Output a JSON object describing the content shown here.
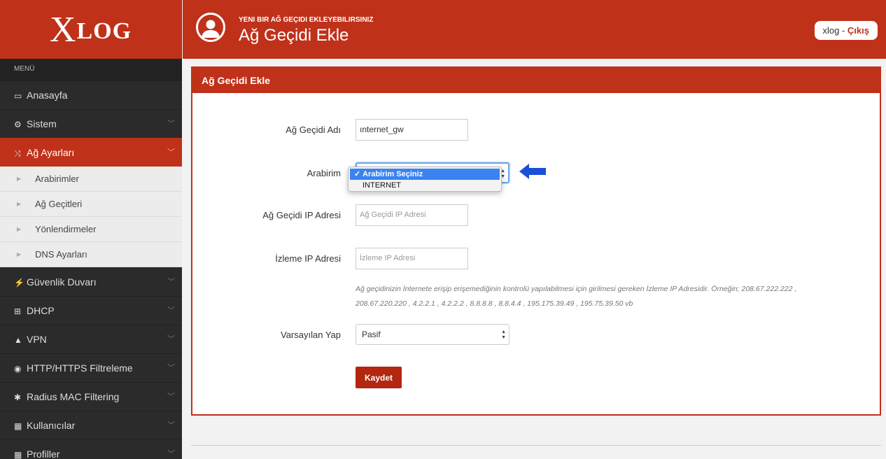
{
  "brand": {
    "logo_x": "X",
    "logo_rest": "LOG"
  },
  "header": {
    "subtitle": "YENI BIR AĞ GEÇIDI EKLEYEBILIRSINIZ",
    "title": "Ağ Geçidi Ekle",
    "user": "xlog",
    "separator": " - ",
    "logout": "Çıkış"
  },
  "sidebar": {
    "menu_label": "MENÜ",
    "items": [
      {
        "label": "Anasayfa",
        "icon": "laptop-icon",
        "glyph": "▭",
        "chevron": false
      },
      {
        "label": "Sistem",
        "icon": "gears-icon",
        "glyph": "⚙",
        "chevron": true
      },
      {
        "label": "Ağ Ayarları",
        "icon": "shuffle-icon",
        "glyph": "⤨",
        "chevron": true,
        "active": true
      },
      {
        "label": "Güvenlik Duvarı",
        "icon": "bolt-icon",
        "glyph": "⚡",
        "chevron": true
      },
      {
        "label": "DHCP",
        "icon": "sitemap-icon",
        "glyph": "⊞",
        "chevron": true
      },
      {
        "label": "VPN",
        "icon": "road-icon",
        "glyph": "▲",
        "chevron": true
      },
      {
        "label": "HTTP/HTTPS Filtreleme",
        "icon": "eye-slash-icon",
        "glyph": "◉",
        "chevron": true
      },
      {
        "label": "Radius MAC Filtering",
        "icon": "asterisk-icon",
        "glyph": "✱",
        "chevron": true
      },
      {
        "label": "Kullanıcılar",
        "icon": "grid-icon",
        "glyph": "▦",
        "chevron": true
      },
      {
        "label": "Profiller",
        "icon": "grid-icon",
        "glyph": "▦",
        "chevron": true
      }
    ],
    "subitems": [
      "Arabirimler",
      "Ağ Geçitleri",
      "Yönlendirmeler",
      "DNS Ayarları"
    ]
  },
  "panel": {
    "heading": "Ağ Geçidi Ekle",
    "gateway_name_label": "Ağ Geçidi Adı",
    "gateway_name_value": "ınternet_gw",
    "interface_label": "Arabirim",
    "interface_options": [
      "Arabirim Seçiniz",
      "INTERNET"
    ],
    "gateway_ip_label": "Ağ Geçidi IP Adresi",
    "gateway_ip_placeholder": "Ağ Geçidi IP Adresi",
    "monitor_ip_label": "İzleme IP Adresi",
    "monitor_ip_placeholder": "İzleme IP Adresi",
    "help_text": "Ağ geçidinizin İnternete erişip erişemediğinin kontrolü yapılabilmesi için girilmesi gereken İzleme IP Adresidir. Örneğin; 208.67.222.222 , 208.67.220.220 , 4.2.2.1 , 4.2.2.2 , 8.8.8.8 , 8.8.4.4 , 195.175.39.49 , 195.75.39.50 vb",
    "default_label": "Varsayılan Yap",
    "default_value": "Pasif",
    "save_label": "Kaydet"
  },
  "colors": {
    "brand_red": "#c0311a",
    "sidebar_dark": "#2b2b2b",
    "select_highlight": "#3a83f0",
    "annotation_arrow": "#1a4fd6"
  }
}
